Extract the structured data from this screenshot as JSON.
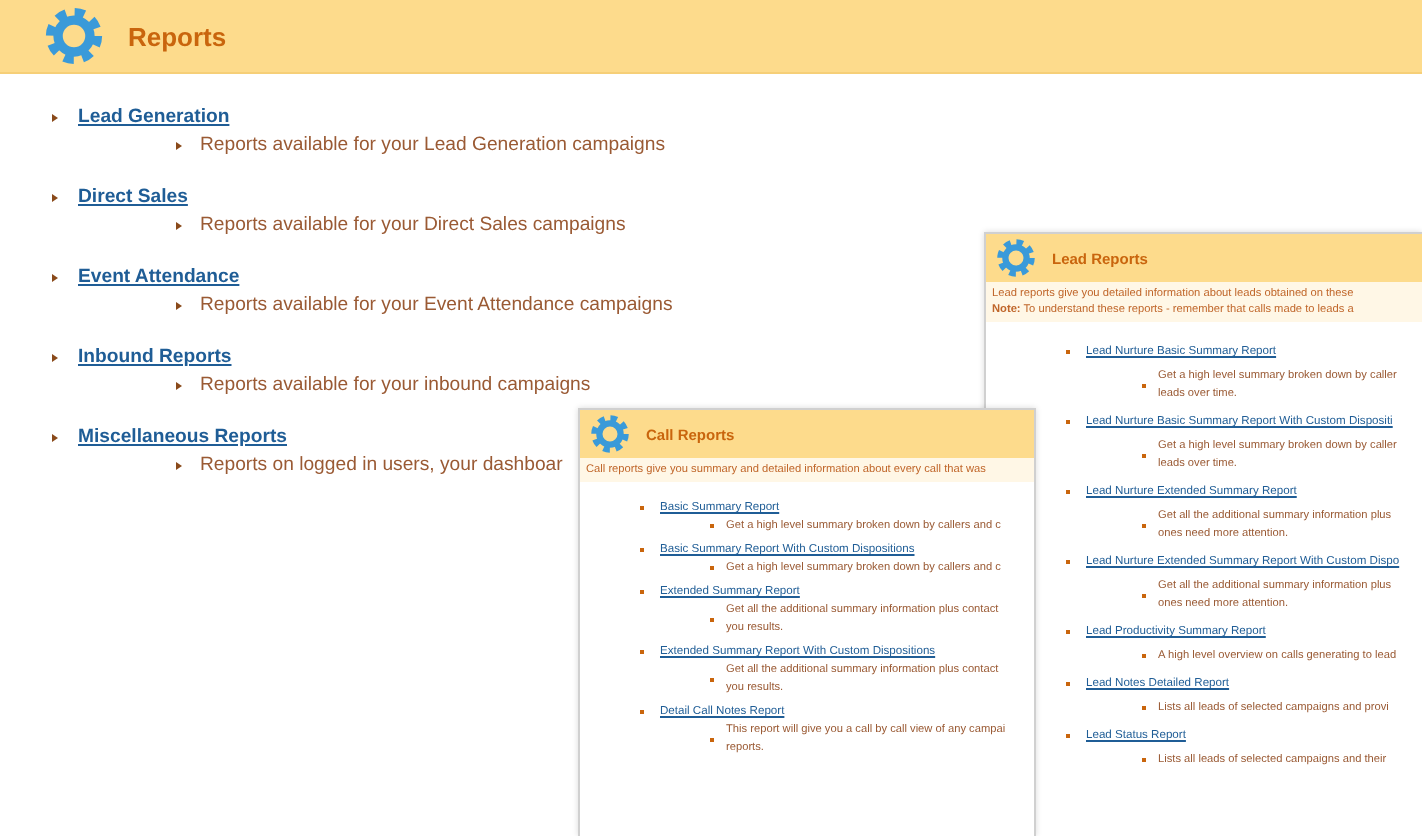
{
  "header": {
    "title": "Reports"
  },
  "categories": [
    {
      "title": "Lead Generation",
      "description": "Reports available for your Lead Generation campaigns"
    },
    {
      "title": "Direct Sales",
      "description": "Reports available for your Direct Sales campaigns"
    },
    {
      "title": "Event Attendance",
      "description": "Reports available for your Event Attendance campaigns"
    },
    {
      "title": "Inbound Reports",
      "description": "Reports available for your inbound campaigns"
    },
    {
      "title": "Miscellaneous Reports",
      "description": "Reports on logged in users, your dashboar"
    }
  ],
  "lead_reports_window": {
    "title": "Lead Reports",
    "intro": [
      "Lead reports give you detailed information about leads obtained on these",
      "**Note:** To understand these reports - remember that calls made to leads a"
    ],
    "reports": [
      {
        "title": "Lead Nurture Basic Summary Report",
        "description": [
          "Get a high level summary broken down by caller",
          "leads over time."
        ]
      },
      {
        "title": "Lead Nurture Basic Summary Report With Custom Dispositi",
        "description": [
          "Get a high level summary broken down by caller",
          "leads over time."
        ]
      },
      {
        "title": "Lead Nurture Extended Summary Report",
        "description": [
          "Get all the additional summary information plus",
          "ones need more attention."
        ]
      },
      {
        "title": "Lead Nurture Extended Summary Report With Custom Dispo",
        "description": [
          "Get all the additional summary information plus",
          "ones need more attention."
        ]
      },
      {
        "title": "Lead Productivity Summary Report",
        "description": [
          "A high level overview on calls generating to lead"
        ]
      },
      {
        "title": "Lead Notes Detailed Report",
        "description": [
          "Lists all leads of selected campaigns and provi"
        ]
      },
      {
        "title": "Lead Status Report",
        "description": [
          "Lists all leads of selected campaigns and their"
        ]
      }
    ]
  },
  "call_reports_window": {
    "title": "Call Reports",
    "intro": [
      "Call reports give you summary and detailed information about every call that was"
    ],
    "reports": [
      {
        "title": "Basic Summary Report",
        "description": [
          "Get a high level summary broken down by callers and c"
        ]
      },
      {
        "title": "Basic Summary Report With Custom Dispositions",
        "description": [
          "Get a high level summary broken down by callers and c"
        ]
      },
      {
        "title": "Extended Summary Report",
        "description": [
          "Get all the additional summary information plus contact",
          "you results."
        ]
      },
      {
        "title": "Extended Summary Report With Custom Dispositions",
        "description": [
          "Get all the additional summary information plus contact",
          "you results."
        ]
      },
      {
        "title": "Detail Call Notes Report",
        "description": [
          "This report will give you a call by call view of any campai",
          "reports."
        ]
      }
    ]
  }
}
